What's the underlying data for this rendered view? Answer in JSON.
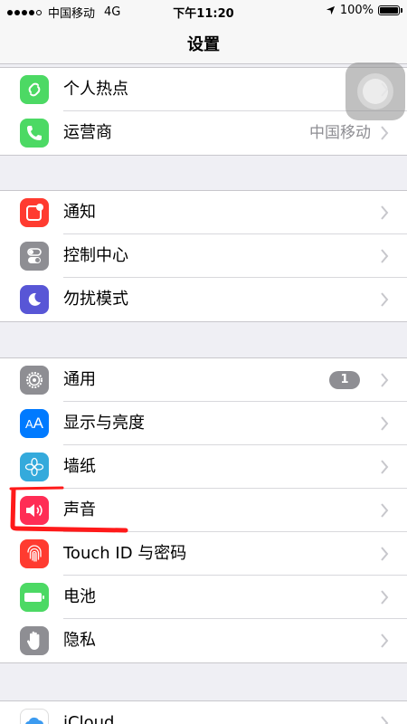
{
  "status_bar": {
    "carrier": "中国移动",
    "network": "4G",
    "time": "下午11:20",
    "battery": "100%"
  },
  "nav": {
    "title": "设置"
  },
  "group1": [
    {
      "label": "个人热点",
      "icon": "hotspot-icon",
      "color": "#4cd964"
    },
    {
      "label": "运营商",
      "value": "中国移动",
      "icon": "phone-icon",
      "color": "#4cd964"
    }
  ],
  "group2": [
    {
      "label": "通知",
      "icon": "notification-icon",
      "color": "#ff3b30"
    },
    {
      "label": "控制中心",
      "icon": "control-center-icon",
      "color": "#8e8e93"
    },
    {
      "label": "勿扰模式",
      "icon": "moon-icon",
      "color": "#5856d6"
    }
  ],
  "group3": [
    {
      "label": "通用",
      "badge": "1",
      "icon": "gear-icon",
      "color": "#8e8e93"
    },
    {
      "label": "显示与亮度",
      "icon": "display-icon",
      "color": "#007aff"
    },
    {
      "label": "墙纸",
      "icon": "wallpaper-icon",
      "color": "#34aadc"
    },
    {
      "label": "声音",
      "icon": "speaker-icon",
      "color": "#ff2d55"
    },
    {
      "label": "Touch ID 与密码",
      "icon": "fingerprint-icon",
      "color": "#ff3b30"
    },
    {
      "label": "电池",
      "icon": "battery-icon",
      "color": "#4cd964"
    },
    {
      "label": "隐私",
      "icon": "hand-icon",
      "color": "#8e8e93"
    }
  ],
  "group4": [
    {
      "label": "iCloud",
      "icon": "icloud-icon",
      "color": "#ffffff"
    }
  ],
  "annotation_color": "#ff1a1a"
}
